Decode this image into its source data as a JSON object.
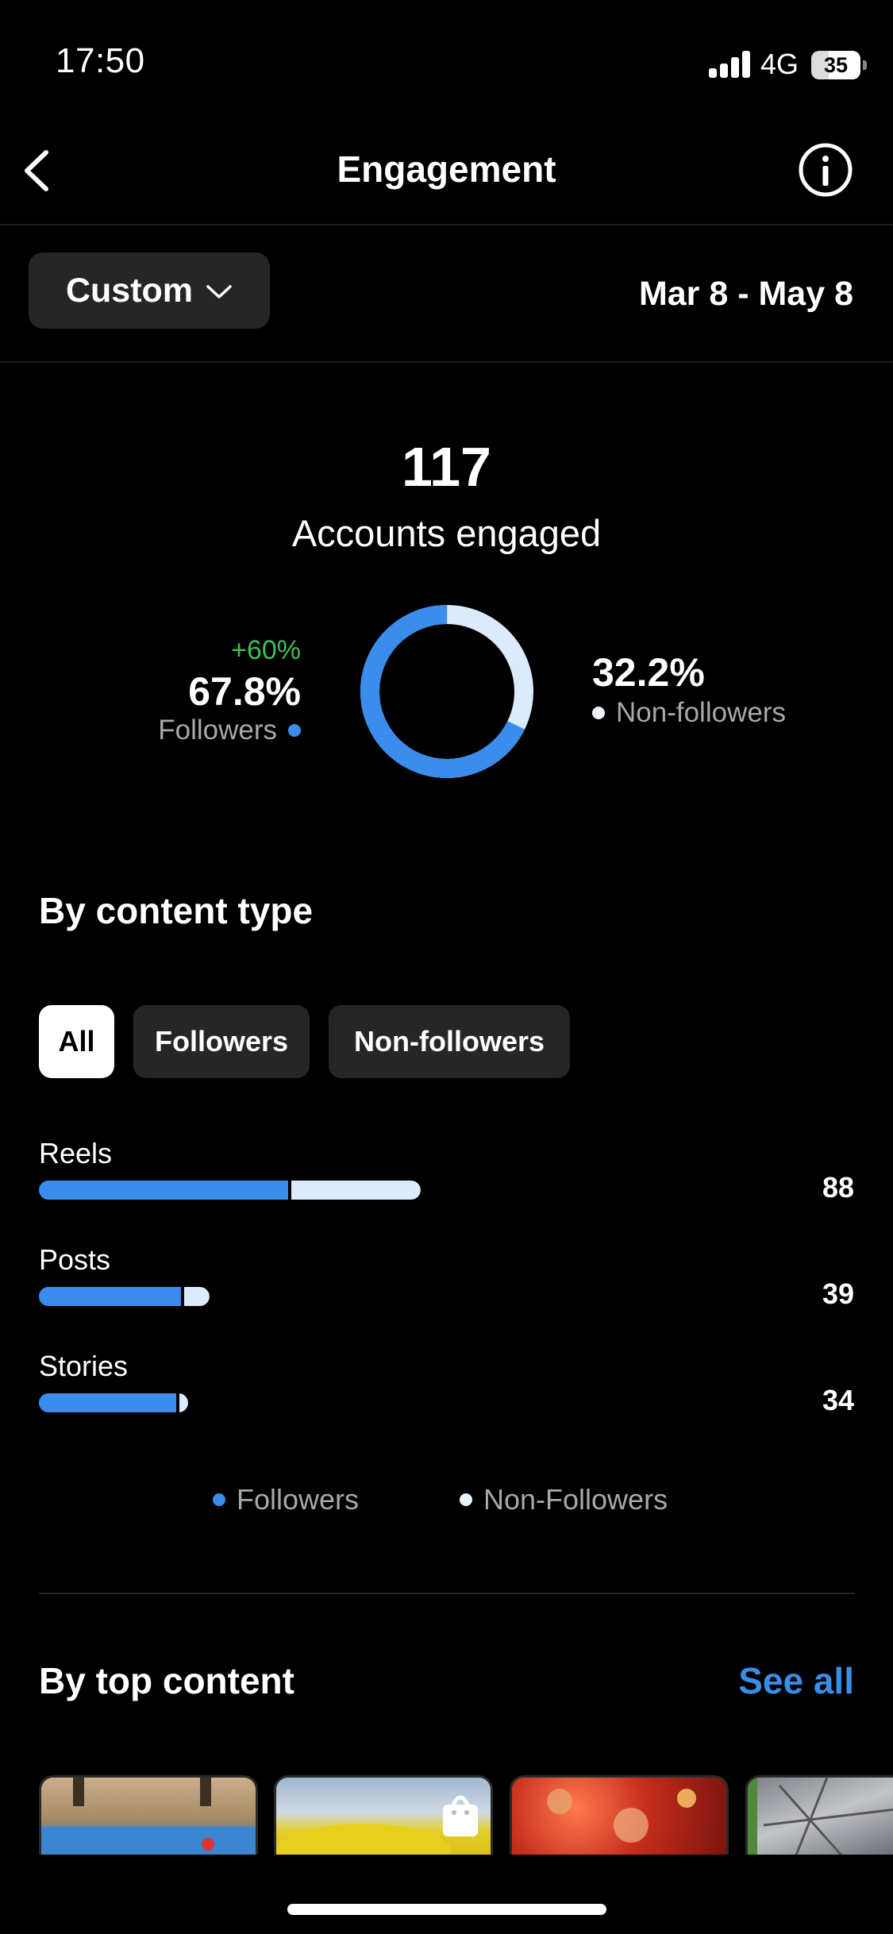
{
  "status_bar": {
    "time": "17:50",
    "network": "4G",
    "battery": "35"
  },
  "header": {
    "title": "Engagement"
  },
  "filter": {
    "period_label": "Custom",
    "date_range": "Mar 8 - May 8"
  },
  "summary": {
    "accounts_engaged": "117",
    "accounts_label": "Accounts engaged",
    "followers_change": "+60%",
    "followers_pct": "67.8%",
    "followers_label": "Followers",
    "nonfollowers_pct": "32.2%",
    "nonfollowers_label": "Non-followers",
    "followers_share": 0.678
  },
  "content_type": {
    "title": "By content type",
    "tabs": [
      {
        "label": "All"
      },
      {
        "label": "Followers"
      },
      {
        "label": "Non-followers"
      }
    ],
    "rows": [
      {
        "label": "Reels",
        "value": "88",
        "followers": 58,
        "nonfollowers": 30
      },
      {
        "label": "Posts",
        "value": "39",
        "followers": 33,
        "nonfollowers": 6
      },
      {
        "label": "Stories",
        "value": "34",
        "followers": 32,
        "nonfollowers": 2
      }
    ],
    "legend": {
      "followers": "Followers",
      "nonfollowers": "Non-Followers"
    }
  },
  "top_content": {
    "title": "By top content",
    "see_all": "See all"
  },
  "colors": {
    "followers": "#3b8ded",
    "nonfollowers": "#dcebfb",
    "accent": "#3a8de6",
    "positive": "#3dbe5a"
  }
}
